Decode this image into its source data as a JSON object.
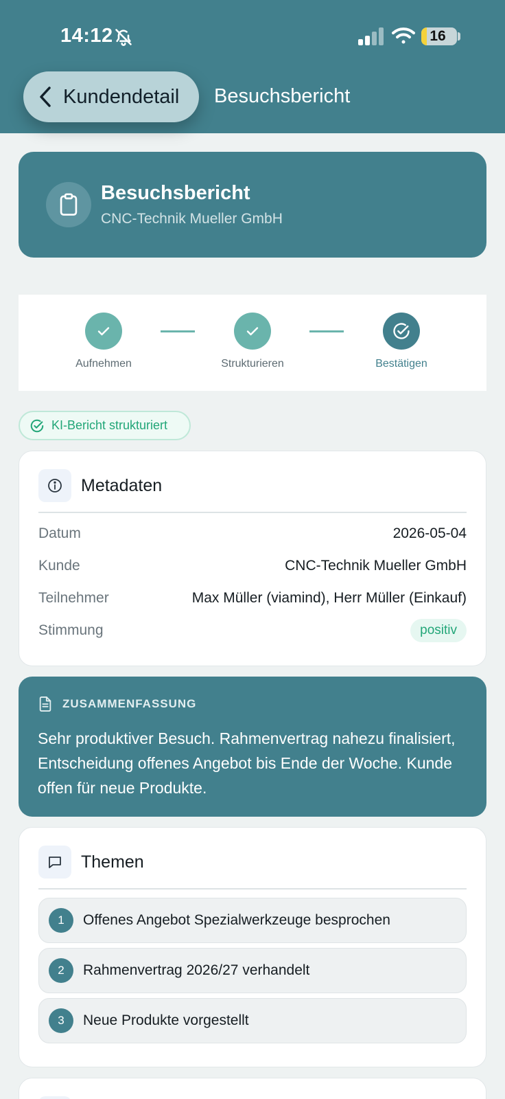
{
  "status": {
    "time": "14:12",
    "battery": "16",
    "battery_level_percent": 16
  },
  "nav": {
    "back_label": "Kundendetail",
    "title": "Besuchsbericht"
  },
  "hero": {
    "title": "Besuchsbericht",
    "subtitle": "CNC-Technik Mueller GmbH",
    "icon": "clipboard-icon"
  },
  "stepper": {
    "steps": [
      {
        "label": "Aufnehmen",
        "state": "done"
      },
      {
        "label": "Strukturieren",
        "state": "done"
      },
      {
        "label": "Bestätigen",
        "state": "active"
      }
    ]
  },
  "ai_badge": {
    "label": "KI-Bericht strukturiert"
  },
  "metadata": {
    "title": "Metadaten",
    "rows": [
      {
        "key": "Datum",
        "value": "2026-05-04"
      },
      {
        "key": "Kunde",
        "value": "CNC-Technik Mueller GmbH"
      },
      {
        "key": "Teilnehmer",
        "value": "Max Müller (viamind), Herr Müller (Einkauf)"
      },
      {
        "key": "Stimmung",
        "value": "positiv"
      }
    ]
  },
  "summary": {
    "label": "ZUSAMMENFASSUNG",
    "text": "Sehr produktiver Besuch. Rahmenvertrag nahezu finalisiert, Entscheidung offenes Angebot bis Ende der Woche. Kunde offen für neue Produkte."
  },
  "topics": {
    "title": "Themen",
    "items": [
      {
        "num": "1",
        "text": "Offenes Angebot Spezialwerkzeuge besprochen"
      },
      {
        "num": "2",
        "text": "Rahmenvertrag 2026/27 verhandelt"
      },
      {
        "num": "3",
        "text": "Neue Produkte vorgestellt"
      }
    ]
  },
  "colors": {
    "primary": "#42808d",
    "done": "#6ab4ac",
    "success": "#22a678",
    "background": "#eef2f2"
  }
}
